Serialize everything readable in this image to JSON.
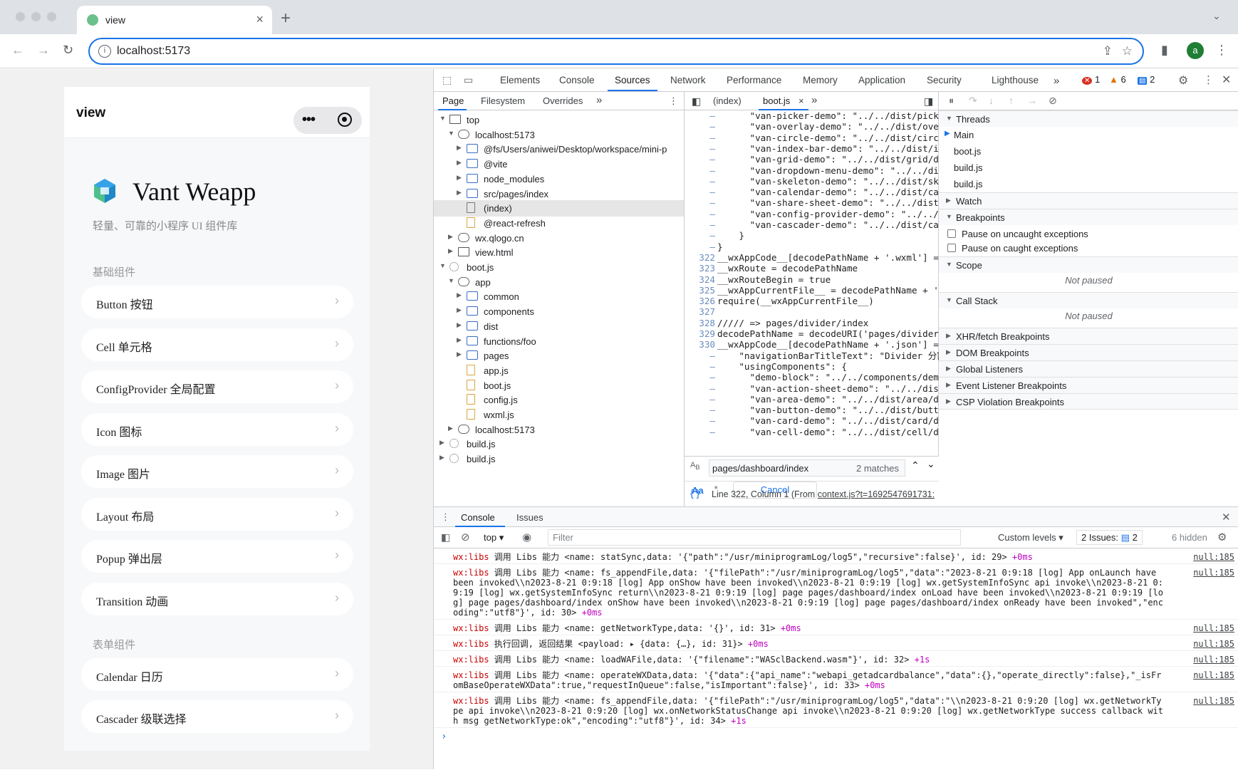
{
  "browser": {
    "tab_title": "view",
    "url": "localhost:5173",
    "avatar_letter": "a"
  },
  "app": {
    "header_title": "view",
    "capsule_menu": "•••",
    "brand": "Vant Weapp",
    "slogan": "轻量、可靠的小程序 UI 组件库",
    "sections": [
      {
        "title": "基础组件",
        "items": [
          "Button 按钮",
          "Cell 单元格",
          "ConfigProvider 全局配置",
          "Icon 图标",
          "Image 图片",
          "Layout 布局",
          "Popup 弹出层",
          "Transition 动画"
        ]
      },
      {
        "title": "表单组件",
        "items": [
          "Calendar 日历",
          "Cascader 级联选择"
        ]
      }
    ]
  },
  "devtools": {
    "tabs": [
      "Elements",
      "Console",
      "Sources",
      "Network",
      "Performance",
      "Memory",
      "Application",
      "Security",
      "Lighthouse"
    ],
    "more": "»",
    "errors": "1",
    "warnings": "6",
    "messages": "2",
    "nav_tabs": [
      "Page",
      "Filesystem",
      "Overrides"
    ],
    "tree": [
      {
        "label": "top",
        "depth": 0,
        "icon": "win",
        "open": true
      },
      {
        "label": "localhost:5173",
        "depth": 1,
        "icon": "cloud",
        "open": true
      },
      {
        "label": "@fs/Users/aniwei/Desktop/workspace/mini-p",
        "depth": 2,
        "icon": "fold",
        "open": false
      },
      {
        "label": "@vite",
        "depth": 2,
        "icon": "fold",
        "open": false
      },
      {
        "label": "node_modules",
        "depth": 2,
        "icon": "fold",
        "open": false
      },
      {
        "label": "src/pages/index",
        "depth": 2,
        "icon": "fold",
        "open": false
      },
      {
        "label": "(index)",
        "depth": 2,
        "icon": "filew",
        "sel": true
      },
      {
        "label": "@react-refresh",
        "depth": 2,
        "icon": "file"
      },
      {
        "label": "wx.qlogo.cn",
        "depth": 1,
        "icon": "cloud",
        "open": false
      },
      {
        "label": "view.html",
        "depth": 1,
        "icon": "win",
        "open": false
      },
      {
        "label": "boot.js",
        "depth": 0,
        "icon": "gear",
        "open": true
      },
      {
        "label": "app",
        "depth": 1,
        "icon": "cloud",
        "open": true
      },
      {
        "label": "common",
        "depth": 2,
        "icon": "fold",
        "open": false
      },
      {
        "label": "components",
        "depth": 2,
        "icon": "fold",
        "open": false
      },
      {
        "label": "dist",
        "depth": 2,
        "icon": "fold",
        "open": false
      },
      {
        "label": "functions/foo",
        "depth": 2,
        "icon": "fold",
        "open": false
      },
      {
        "label": "pages",
        "depth": 2,
        "icon": "fold",
        "open": false
      },
      {
        "label": "app.js",
        "depth": 2,
        "icon": "file"
      },
      {
        "label": "boot.js",
        "depth": 2,
        "icon": "file"
      },
      {
        "label": "config.js",
        "depth": 2,
        "icon": "file"
      },
      {
        "label": "wxml.js",
        "depth": 2,
        "icon": "file"
      },
      {
        "label": "localhost:5173",
        "depth": 1,
        "icon": "cloud",
        "open": false
      },
      {
        "label": "build.js",
        "depth": 0,
        "icon": "gear",
        "open": false
      },
      {
        "label": "build.js",
        "depth": 0,
        "icon": "gear",
        "open": false
      }
    ],
    "editor_tabs": [
      "(index)",
      "boot.js"
    ],
    "code": [
      {
        "n": "–",
        "c": "      \"van-picker-demo\": \"../../dist/picker/"
      },
      {
        "n": "–",
        "c": "      \"van-overlay-demo\": \"../../dist/overla"
      },
      {
        "n": "–",
        "c": "      \"van-circle-demo\": \"../../dist/circle/"
      },
      {
        "n": "–",
        "c": "      \"van-index-bar-demo\": \"../../dist/inde"
      },
      {
        "n": "–",
        "c": "      \"van-grid-demo\": \"../../dist/grid/demo"
      },
      {
        "n": "–",
        "c": "      \"van-dropdown-menu-demo\": \"../../dist/"
      },
      {
        "n": "–",
        "c": "      \"van-skeleton-demo\": \"../../dist/skele"
      },
      {
        "n": "–",
        "c": "      \"van-calendar-demo\": \"../../dist/calen"
      },
      {
        "n": "–",
        "c": "      \"van-share-sheet-demo\": \"../../dist/sh"
      },
      {
        "n": "–",
        "c": "      \"van-config-provider-demo\": \"../../dis"
      },
      {
        "n": "–",
        "c": "      \"van-cascader-demo\": \"../../dist/casca"
      },
      {
        "n": "–",
        "c": "    }"
      },
      {
        "n": "–",
        "c": "}"
      },
      {
        "n": "322",
        "c": "__wxAppCode__[decodePathName + '.wxml'] = $gwx"
      },
      {
        "n": "323",
        "c": "__wxRoute = decodePathName"
      },
      {
        "n": "324",
        "c": "__wxRouteBegin = true"
      },
      {
        "n": "325",
        "c": "__wxAppCurrentFile__ = decodePathName + '.js'"
      },
      {
        "n": "326",
        "c": "require(__wxAppCurrentFile__)"
      },
      {
        "n": "327",
        "c": ""
      },
      {
        "n": "328",
        "c": "///// => pages/divider/index"
      },
      {
        "n": "329",
        "c": "decodePathName = decodeURI('pages/divider/inde"
      },
      {
        "n": "330",
        "c": "__wxAppCode__[decodePathName + '.json'] = {"
      },
      {
        "n": "–",
        "c": "    \"navigationBarTitleText\": \"Divider 分割线\","
      },
      {
        "n": "–",
        "c": "    \"usingComponents\": {"
      },
      {
        "n": "–",
        "c": "      \"demo-block\": \"../../components/demo-b"
      },
      {
        "n": "–",
        "c": "      \"van-action-sheet-demo\": \"../../dist/a"
      },
      {
        "n": "–",
        "c": "      \"van-area-demo\": \"../../dist/area/demo"
      },
      {
        "n": "–",
        "c": "      \"van-button-demo\": \"../../dist/button/"
      },
      {
        "n": "–",
        "c": "      \"van-card-demo\": \"../../dist/card/demo"
      },
      {
        "n": "–",
        "c": "      \"van-cell-demo\": \"../../dist/cell/demo"
      }
    ],
    "find": {
      "value": "pages/dashboard/index",
      "matches": "2 matches",
      "case": "Aa",
      "regex": ".*",
      "cancel": "Cancel"
    },
    "status_line": "Line 322, Column 1",
    "status_from_prefix": "(From ",
    "status_from": "context.js?t=1692547691731:",
    "debugger": {
      "threads": "Threads",
      "main": "Main",
      "thread_items": [
        "boot.js",
        "build.js",
        "build.js"
      ],
      "watch": "Watch",
      "breakpoints": "Breakpoints",
      "pause_uncaught": "Pause on uncaught exceptions",
      "pause_caught": "Pause on caught exceptions",
      "scope": "Scope",
      "not_paused": "Not paused",
      "call_stack": "Call Stack",
      "more_sections": [
        "XHR/fetch Breakpoints",
        "DOM Breakpoints",
        "Global Listeners",
        "Event Listener Breakpoints",
        "CSP Violation Breakpoints"
      ]
    },
    "console": {
      "tabs": [
        "Console",
        "Issues"
      ],
      "context": "top",
      "filter_placeholder": "Filter",
      "levels": "Custom levels ▾",
      "issues": "2 Issues:",
      "issues_count": "2",
      "hidden": "6 hidden",
      "messages": [
        {
          "pre": "wx:libs",
          "body": " 调用 Libs 能力 <name: statSync,data: '{\"path\":\"/usr/miniprogramLog/log5\",\"recursive\":false}', id: 29> ",
          "time": "+0ms",
          "src": "null:185",
          "lines": 1
        },
        {
          "pre": "wx:libs",
          "body": " 调用 Libs 能力 <name: fs_appendFile,data: '{\"filePath\":\"/usr/miniprogramLog/log5\",\"data\":\"2023-8-21 0:9:18 [log] App onLaunch have been invoked\\\\n2023-8-21 0:9:18 [log] App onShow have been invoked\\\\n2023-8-21 0:9:19 [log] wx.getSystemInfoSync api invoke\\\\n2023-8-21 0:9:19 [log] wx.getSystemInfoSync return\\\\n2023-8-21 0:9:19 [log] page pages/dashboard/index onLoad have been invoked\\\\n2023-8-21 0:9:19 [log] page pages/dashboard/index onShow have been invoked\\\\n2023-8-21 0:9:19 [log] page pages/dashboard/index onReady have been invoked\",\"encoding\":\"utf8\"}', id: 30> ",
          "time": "+0ms",
          "src": "null:185",
          "lines": 5
        },
        {
          "pre": "wx:libs",
          "body": " 调用 Libs 能力 <name: getNetworkType,data: '{}', id: 31> ",
          "time": "+0ms",
          "src": "null:185",
          "lines": 1
        },
        {
          "pre": "wx:libs",
          "body": " 执行回调, 返回结果 <payload: ▸ {data: {…}, id: 31}> ",
          "time": "+0ms",
          "src": "null:185",
          "lines": 1
        },
        {
          "pre": "wx:libs",
          "body": " 调用 Libs 能力 <name: loadWAFile,data: '{\"filename\":\"WASclBackend.wasm\"}', id: 32> ",
          "time": "+1s",
          "src": "null:185",
          "lines": 1
        },
        {
          "pre": "wx:libs",
          "body": " 调用 Libs 能力 <name: operateWXData,data: '{\"data\":{\"api_name\":\"webapi_getadcardbalance\",\"data\":{},\"operate_directly\":false},\"_isFromBaseOperateWXData\":true,\"requestInQueue\":false,\"isImportant\":false}', id: 33> ",
          "time": "+0ms",
          "src": "null:185",
          "lines": 2
        },
        {
          "pre": "wx:libs",
          "body": " 调用 Libs 能力 <name: fs_appendFile,data: '{\"filePath\":\"/usr/miniprogramLog/log5\",\"data\":\"\\\\n2023-8-21 0:9:20 [log] wx.getNetworkType api invoke\\\\n2023-8-21 0:9:20 [log] wx.onNetworkStatusChange api invoke\\\\n2023-8-21 0:9:20 [log] wx.getNetworkType success callback with msg getNetworkType:ok\",\"encoding\":\"utf8\"}', id: 34> ",
          "time": "+1s",
          "src": "null:185",
          "lines": 3
        }
      ],
      "prompt": "›"
    }
  }
}
